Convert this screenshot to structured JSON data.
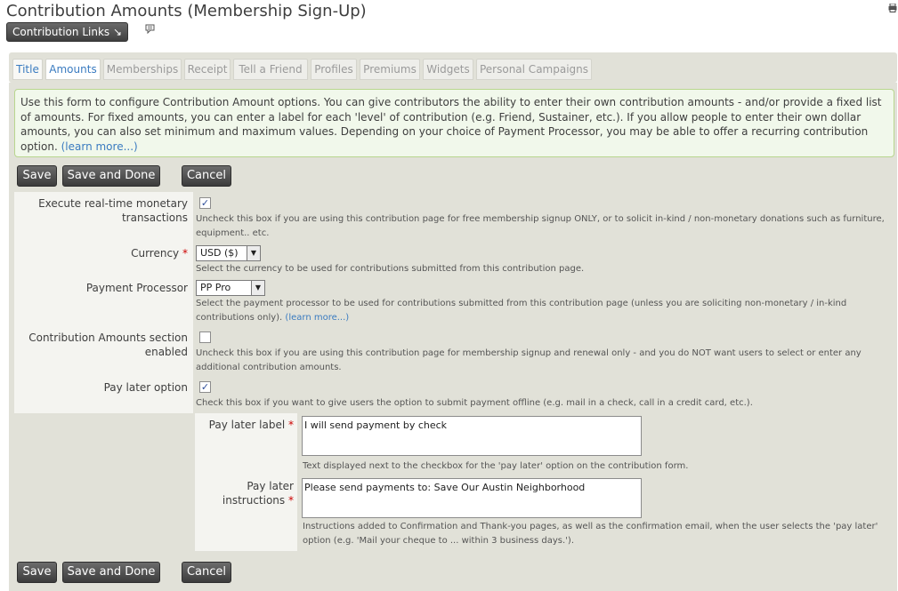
{
  "page": {
    "title": "Contribution Amounts (Membership Sign-Up)",
    "links_button": "Contribution Links ↘"
  },
  "tabs": [
    "Title",
    "Amounts",
    "Memberships",
    "Receipt",
    "Tell a Friend",
    "Profiles",
    "Premiums",
    "Widgets",
    "Personal Campaigns"
  ],
  "active_tab": "Amounts",
  "help": {
    "text": "Use this form to configure Contribution Amount options. You can give contributors the ability to enter their own contribution amounts - and/or provide a fixed list of amounts. For fixed amounts, you can enter a label for each 'level' of contribution (e.g. Friend, Sustainer, etc.). If you allow people to enter their own dollar amounts, you can also set minimum and maximum values. Depending on your choice of Payment Processor, you may be able to offer a recurring contribution option.",
    "learn_more": "(learn more...)"
  },
  "buttons": {
    "save": "Save",
    "save_done": "Save and Done",
    "cancel": "Cancel"
  },
  "fields": {
    "realtime": {
      "label": "Execute real-time monetary transactions",
      "checked": true,
      "description": "Uncheck this box if you are using this contribution page for free membership signup ONLY, or to solicit in-kind / non-monetary donations such as furniture, equipment.. etc."
    },
    "currency": {
      "label": "Currency",
      "value": "USD ($)",
      "description": "Select the currency to be used for contributions submitted from this contribution page."
    },
    "processor": {
      "label": "Payment Processor",
      "value": "PP Pro",
      "description": "Select the payment processor to be used for contributions submitted from this contribution page (unless you are soliciting non-monetary / in-kind contributions only).",
      "learn_more": "(learn more...)"
    },
    "amounts_enabled": {
      "label": "Contribution Amounts section enabled",
      "checked": false,
      "description": "Uncheck this box if you are using this contribution page for membership signup and renewal only - and you do NOT want users to select or enter any additional contribution amounts."
    },
    "pay_later": {
      "label": "Pay later option",
      "checked": true,
      "description": "Check this box if you want to give users the option to submit payment offline (e.g. mail in a check, call in a credit card, etc.)."
    },
    "pay_later_label": {
      "label": "Pay later label",
      "value": "I will send payment by check",
      "description": "Text displayed next to the checkbox for the 'pay later' option on the contribution form."
    },
    "pay_later_instructions": {
      "label": "Pay later instructions",
      "value": "Please send payments to: Save Our Austin Neighborhood",
      "description": "Instructions added to Confirmation and Thank-you pages, as well as the confirmation email, when the user selects the 'pay later' option (e.g. 'Mail your cheque to ... within 3 business days.')."
    }
  }
}
